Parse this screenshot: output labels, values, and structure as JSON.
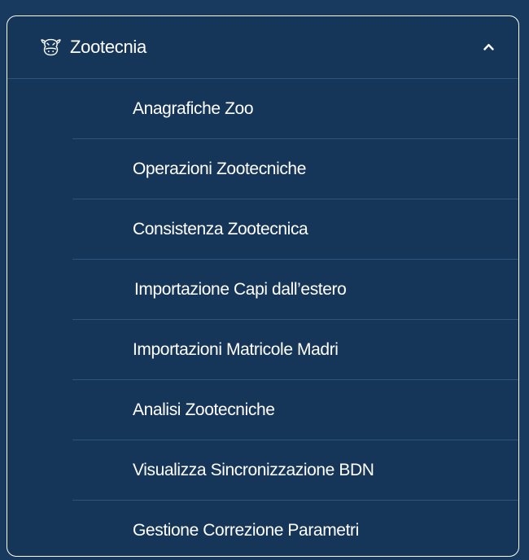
{
  "theme": {
    "background": "#173a5e",
    "panel": "#163659",
    "text": "#ffffff",
    "divider": "#2c557e"
  },
  "menu": {
    "section": {
      "label": "Zootecnia",
      "icon": "cow-icon",
      "expanded": true,
      "toggle_icon": "chevron-up-icon"
    },
    "items": [
      {
        "label": "Anagrafiche Zoo"
      },
      {
        "label": "Operazioni Zootecniche"
      },
      {
        "label": "Consistenza Zootecnica"
      },
      {
        "label": "Importazione Capi dall’estero"
      },
      {
        "label": "Importazioni Matricole Madri"
      },
      {
        "label": "Analisi Zootecniche"
      },
      {
        "label": "Visualizza Sincronizzazione BDN"
      },
      {
        "label": "Gestione Correzione Parametri"
      }
    ]
  }
}
